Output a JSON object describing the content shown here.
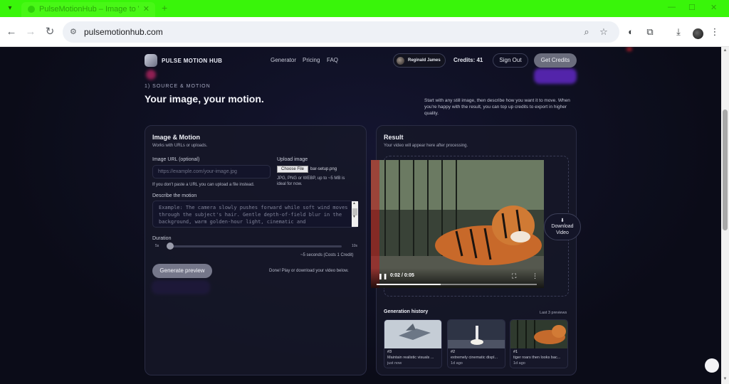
{
  "browser": {
    "tab_title": "PulseMotionHub – Image to Vi",
    "url": "pulsemotionhub.com"
  },
  "nav": {
    "brand": "PULSE MOTION HUB",
    "links": [
      "Generator",
      "Pricing",
      "FAQ"
    ],
    "user_name": "Reginald James",
    "credits_label": "Credits:",
    "credits_value": "41",
    "signout_label": "Sign Out",
    "getcredits_label": "Get Credits"
  },
  "hero": {
    "step_label": "1) SOURCE & MOTION",
    "headline": "Your image, your motion.",
    "intro": "Start with any still image, then describe how you want it to move. When you're happy with the result, you can top up credits to export in higher quality."
  },
  "form": {
    "title": "Image & Motion",
    "subtitle": "Works with URLs or uploads.",
    "url_label": "Image URL (optional)",
    "url_placeholder": "https://example.com/your-image.jpg",
    "url_hint": "If you don't paste a URL you can upload a file instead.",
    "upload_label": "Upload image",
    "choose_file": "Choose File",
    "file_name": "bar-setup.png",
    "upload_hint_1": "JPG, PNG or WEBP, up to ~5 MB is",
    "upload_hint_2": "ideal for now.",
    "motion_label": "Describe the motion",
    "motion_placeholder": "Example: The camera slowly pushes forward while soft wind moves through the subject's hair. Gentle depth-of-field blur in the background, warm golden-hour light, cinematic and",
    "duration_label": "Duration",
    "duration_min": "5s",
    "duration_max": "10s",
    "duration_value": 0,
    "duration_note": "~5 seconds (Costs 1 Credit)",
    "generate_label": "Generate preview",
    "status": "Done! Play or download your video below."
  },
  "result": {
    "title": "Result",
    "subtitle": "Your video will appear here after processing.",
    "video_time": "0:02 / 0:05",
    "video_progress": 0.4,
    "download_icon": "download-icon",
    "download_label_1": "Download",
    "download_label_2": "Video"
  },
  "history": {
    "title": "Generation history",
    "note": "Last 3 previews",
    "items": [
      {
        "id": "#3",
        "text": "Maintain realistic visuals ...",
        "time": "just now"
      },
      {
        "id": "#2",
        "text": "extremely cinematic displ...",
        "time": "1d ago"
      },
      {
        "id": "#1",
        "text": "tiger roars then looks bac...",
        "time": "1d ago"
      }
    ]
  },
  "colors": {
    "brand_green_tab": "#39f50a",
    "page_bg": "#0b0c18",
    "card_border": "#2a2c44",
    "accent_glow": "#6a2bd8"
  }
}
